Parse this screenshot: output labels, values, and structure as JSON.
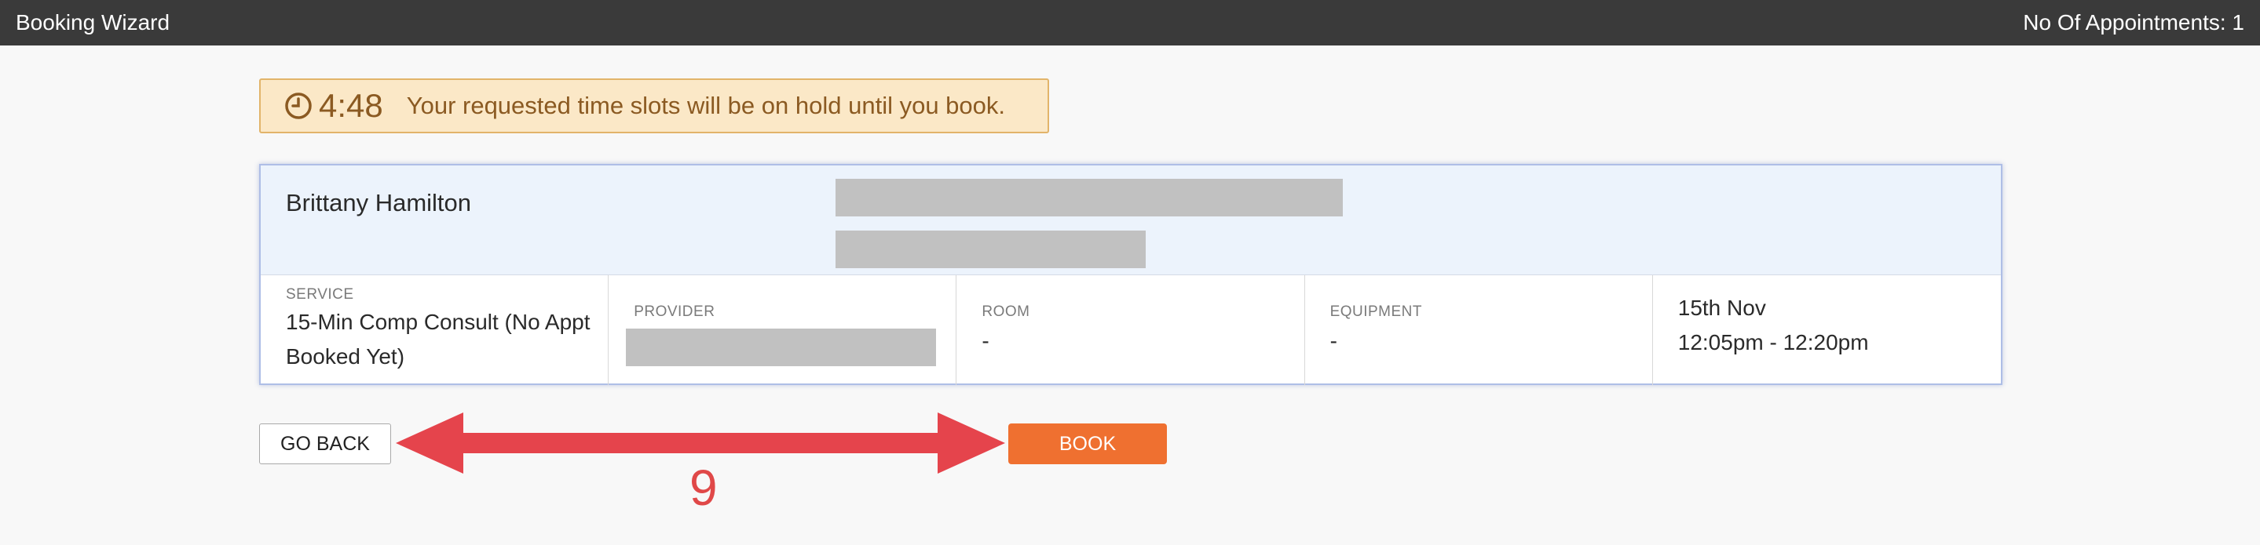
{
  "topbar": {
    "title": "Booking Wizard",
    "appointments": "No Of Appointments: 1"
  },
  "timer": {
    "value": "4:48",
    "message": "Your requested time slots will be on hold until you book.",
    "icon": "clock-icon"
  },
  "booking": {
    "client_name": "Brittany Hamilton",
    "service_label": "SERVICE",
    "service_line1": "15-Min Comp Consult (No Appt",
    "service_line2": "Booked Yet)",
    "provider_label": "PROVIDER",
    "room_label": "ROOM",
    "room_value": "-",
    "equipment_label": "EQUIPMENT",
    "equipment_value": "-",
    "date": "15th Nov",
    "time": "12:05pm - 12:20pm"
  },
  "actions": {
    "back_label": "GO BACK",
    "book_label": "BOOK"
  },
  "annotation": {
    "label": "9",
    "color": "#e04848"
  }
}
